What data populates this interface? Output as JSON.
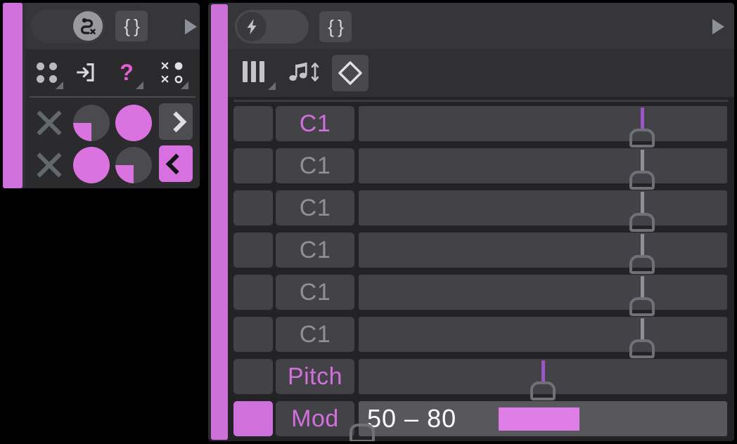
{
  "theme": {
    "accent_pink": "#d070dd",
    "accent_magenta": "#e45fd0",
    "panel_bg": "#2b2b2e",
    "header_bg": "#36363a",
    "row_bg": "#424247",
    "row_bg_active": "#58585c",
    "text_light": "#c3c5c9",
    "text_dim": "#8f9194",
    "handle_stroke": "#6f7178",
    "handle_stem_active": "#9a55c8"
  },
  "left_panel": {
    "header": {
      "toggle": {
        "name": "route-bypass-toggle",
        "state": "on",
        "icon": "route-x-icon"
      },
      "brace_button": {
        "label": "{ }",
        "icon": "braces-icon"
      },
      "play_button": {
        "icon": "play-triangle-icon"
      }
    },
    "tool_row": [
      {
        "icon": "four-dots-icon",
        "has_menu_corner": true
      },
      {
        "icon": "login-arrow-icon",
        "has_menu_corner": false
      },
      {
        "icon": "question-mark-icon",
        "label": "?",
        "has_menu_corner": true
      },
      {
        "icon": "x-o-grid-icon",
        "has_menu_corner": true
      }
    ],
    "prob_rows": [
      {
        "clear": {
          "icon": "x-clear-icon"
        },
        "pie_a": {
          "icon": "pie-chart-icon",
          "fill_pct": 25,
          "filled": false
        },
        "pie_b": {
          "icon": "pie-chart-icon",
          "fill_pct": 100,
          "filled": true
        },
        "nav": {
          "icon": "chevron-right-icon",
          "label": ">",
          "active": false
        }
      },
      {
        "clear": {
          "icon": "x-clear-icon"
        },
        "pie_a": {
          "icon": "pie-chart-icon",
          "fill_pct": 100,
          "filled": true
        },
        "pie_b": {
          "icon": "pie-chart-icon",
          "fill_pct": 25,
          "filled": false
        },
        "nav": {
          "icon": "chevron-left-icon",
          "label": "<",
          "active": true
        }
      }
    ]
  },
  "right_panel": {
    "header": {
      "toggle": {
        "name": "trigger-toggle",
        "state": "off",
        "icon": "lightning-bolt-icon"
      },
      "brace_button": {
        "label": "{ }",
        "icon": "braces-icon"
      },
      "play_button": {
        "icon": "play-triangle-icon"
      }
    },
    "tool_row": [
      {
        "icon": "piano-keys-icon",
        "has_menu_corner": true,
        "active": false
      },
      {
        "icon": "note-updown-icon",
        "has_menu_corner": false,
        "active": false
      },
      {
        "icon": "diamond-chevrons-icon",
        "has_menu_corner": false,
        "active": true
      }
    ],
    "rows": [
      {
        "label": "C1",
        "label_active": true,
        "switch_on": false,
        "handle_pct": 77,
        "stem_active": true,
        "type": "note"
      },
      {
        "label": "C1",
        "label_active": false,
        "switch_on": false,
        "handle_pct": 77,
        "stem_active": false,
        "type": "note"
      },
      {
        "label": "C1",
        "label_active": false,
        "switch_on": false,
        "handle_pct": 77,
        "stem_active": false,
        "type": "note"
      },
      {
        "label": "C1",
        "label_active": false,
        "switch_on": false,
        "handle_pct": 77,
        "stem_active": false,
        "type": "note"
      },
      {
        "label": "C1",
        "label_active": false,
        "switch_on": false,
        "handle_pct": 77,
        "stem_active": false,
        "type": "note"
      },
      {
        "label": "C1",
        "label_active": false,
        "switch_on": false,
        "handle_pct": 77,
        "stem_active": false,
        "type": "note"
      },
      {
        "label": "Pitch",
        "label_active": true,
        "switch_on": false,
        "handle_pct": 50,
        "stem_active": true,
        "type": "pitch"
      },
      {
        "label": "Mod",
        "label_active": true,
        "switch_on": true,
        "handle_pct": 1,
        "stem_active": false,
        "type": "mod",
        "value_text": "50 – 80",
        "range_start_pct": 38,
        "range_end_pct": 60
      }
    ]
  }
}
